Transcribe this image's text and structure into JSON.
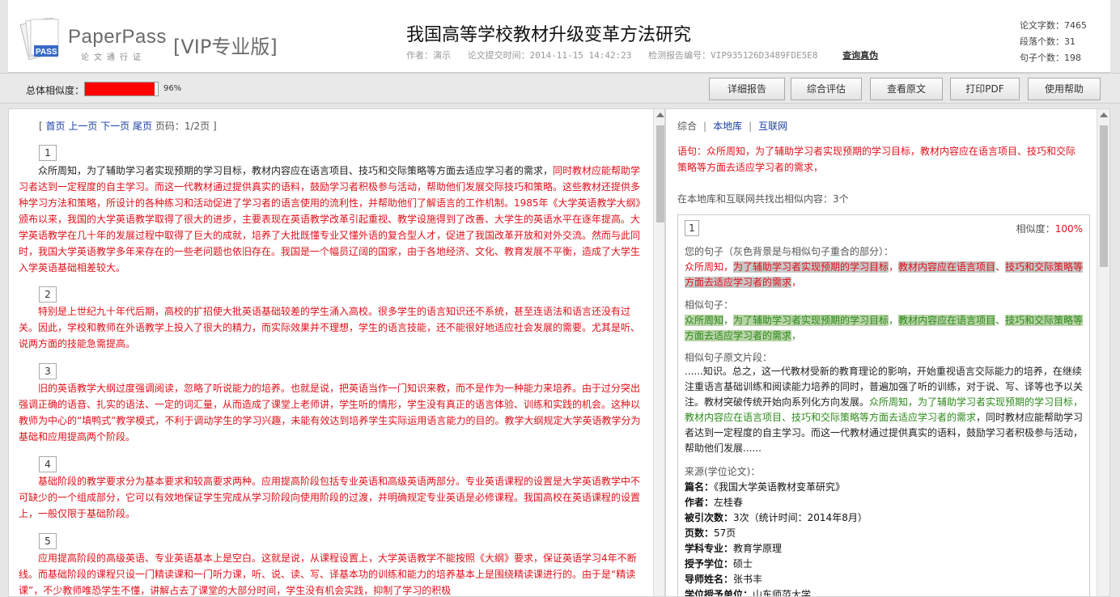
{
  "header": {
    "brand": "PaperPass",
    "slogan": "论文通行证",
    "edition": "[VIP专业版]",
    "logo_tag": "PASS",
    "title": "我国高等学校教材升级变革方法研究",
    "author": "作者：演示",
    "submit_time": "论文提交时间：2014-11-15 14:42:23",
    "report_id": "检测报告编号：VIP935126D3489FDE5E8",
    "lookup_label": "查询真伪",
    "stats": [
      "论文字数：7465",
      "段落个数：31",
      "句子个数：198"
    ]
  },
  "toolbar": {
    "similarity_label": "总体相似度：",
    "similarity_value": 0.96,
    "similarity_text": "96%",
    "buttons": [
      "详细报告",
      "综合评估",
      "查看原文",
      "打印PDF",
      "使用帮助"
    ]
  },
  "left": {
    "pager": {
      "first": "首页",
      "prev": "上一页",
      "next": "下一页",
      "last": "尾页",
      "page_info": "页码：1/2页"
    },
    "paragraphs": [
      {
        "num": "1",
        "text_normal": "众所周知，为了辅助学习者实现预期的学习目标，教材内容应在语言项目、技巧和交际策略等方面去适应学习者的需求，",
        "text_red": "同时教材应能帮助学习者达到一定程度的自主学习。而这一代教材通过提供真实的语料，鼓励学习者积极参与活动，帮助他们发展交际技巧和策略。这些教材还提供多种学习方法和策略，所设计的各种练习和活动促进了学习者的语言使用的流利性，并帮助他们了解语言的工作机制。1985年《大学英语教学大纲》颁布以来，我国的大学英语教学取得了很大的进步，主要表现在英语教学改革引起重视、教学设施得到了改善、大学生的英语水平在逐年提高。大学英语教学在几十年的发展过程中取得了巨大的成就，培养了大批既懂专业又懂外语的复合型人才，促进了我国改革开放和对外交流。然而与此同时，我国大学英语教学多年来存在的一些老问题也依旧存在。我国是一个幅员辽阔的国家，由于各地经济、文化、教育发展不平衡，造成了大学生入学英语基础相差较大。"
      },
      {
        "num": "2",
        "text_normal": "",
        "text_red": "特别是上世纪九十年代后期，高校的扩招使大批英语基础较差的学生涌入高校。很多学生的语言知识还不系统，甚至连语法和语言还没有过关。因此，学校和教师在外语教学上投入了很大的精力，而实际效果并不理想，学生的语言技能，还不能很好地适应社会发展的需要。尤其是听、说两方面的技能急需提高。"
      },
      {
        "num": "3",
        "text_normal": "",
        "text_red": "旧的英语教学大纲过度强调阅读，忽略了听说能力的培养。也就是说，把英语当作一门知识来教，而不是作为一种能力来培养。由于过分突出强调正确的语音、扎实的语法、一定的词汇量，从而造成了课堂上老师讲，学生听的情形，学生没有真正的语言体验、训练和实践的机会。这种以教师为中心的“填鸭式”教学模式，不利于调动学生的学习兴趣，未能有效达到培养学生实际运用语言能力的目的。教学大纲规定大学英语教学分为基础和应用提高两个阶段。"
      },
      {
        "num": "4",
        "text_normal": "",
        "text_red": "基础阶段的教学要求分为基本要求和较高要求两种。应用提高阶段包括专业英语和高级英语两部分。专业英语课程的设置是大学英语教学中不可缺少的一个组成部分，它可以有效地保证学生完成从学习阶段向使用阶段的过渡，并明确规定专业英语是必修课程。我国高校在英语课程的设置上，一般仅限于基础阶段。"
      },
      {
        "num": "5",
        "text_normal": "",
        "text_red": "应用提高阶段的高级英语、专业英语基本上是空白。这就是说，从课程设置上，大学英语教学不能按照《大纲》要求，保证英语学习4年不断线。而基础阶段的课程只设一门精读课和一门听力课，听、说、读、写、译基本功的训练和能力的培养基本上是围绕精读课进行的。由于是“精读课”，不少教师唯恐学生不懂，讲解占去了课堂的大部分时间，学生没有机会实践，抑制了学习的积极"
      }
    ]
  },
  "right": {
    "tabs": [
      "综合",
      "本地库",
      "互联网"
    ],
    "sentence_label": "语句：",
    "sentence": "众所周知，为了辅助学习者实现预期的学习目标，教材内容应在语言项目、技巧和交际策略等方面去适应学习者的需求，",
    "found_text": "在本地库和互联网共找出相似内容：3个",
    "card": {
      "num": "1",
      "similarity_label": "相似度：",
      "similarity_value": "100%",
      "your_sentence_label": "您的句子（灰色背景是与相似句子重合的部分）：",
      "similar_sentence_label": "相似句子：",
      "original_label": "相似句子原文片段：",
      "original_before": "......知识。总之，这一代教材受新的教育理论的影响，开始重视语言交际能力的培养，在继续注重语言基础训练和阅读能力培养的同时，普遍加强了听的训练，对于说、写、译等也予以关注。教材突破传统开始向系列化方向发展。",
      "original_match": "众所周知，为了辅助学习者实现预期的学习目标，教材内容应在语言项目、技巧和交际策略等方面去适应学习者的需求",
      "original_after": "，同时教材应能帮助学习者达到一定程度的自主学习。而这一代教材通过提供真实的语料，鼓励学习者积极参与活动，帮助他们发展......",
      "source_label": "来源(学位论文)：",
      "source": [
        {
          "k": "篇名：",
          "v": "《我国大学英语教材变革研究》"
        },
        {
          "k": "作者：",
          "v": "左桂春"
        },
        {
          "k": "被引次数：",
          "v": "3次（统计时间：2014年8月）"
        },
        {
          "k": "页数：",
          "v": "57页"
        },
        {
          "k": "学科专业：",
          "v": "教育学原理"
        },
        {
          "k": "授予学位：",
          "v": "硕士"
        },
        {
          "k": "导师姓名：",
          "v": "张书丰"
        },
        {
          "k": "学位授予单位：",
          "v": "山东师范大学"
        }
      ]
    }
  }
}
